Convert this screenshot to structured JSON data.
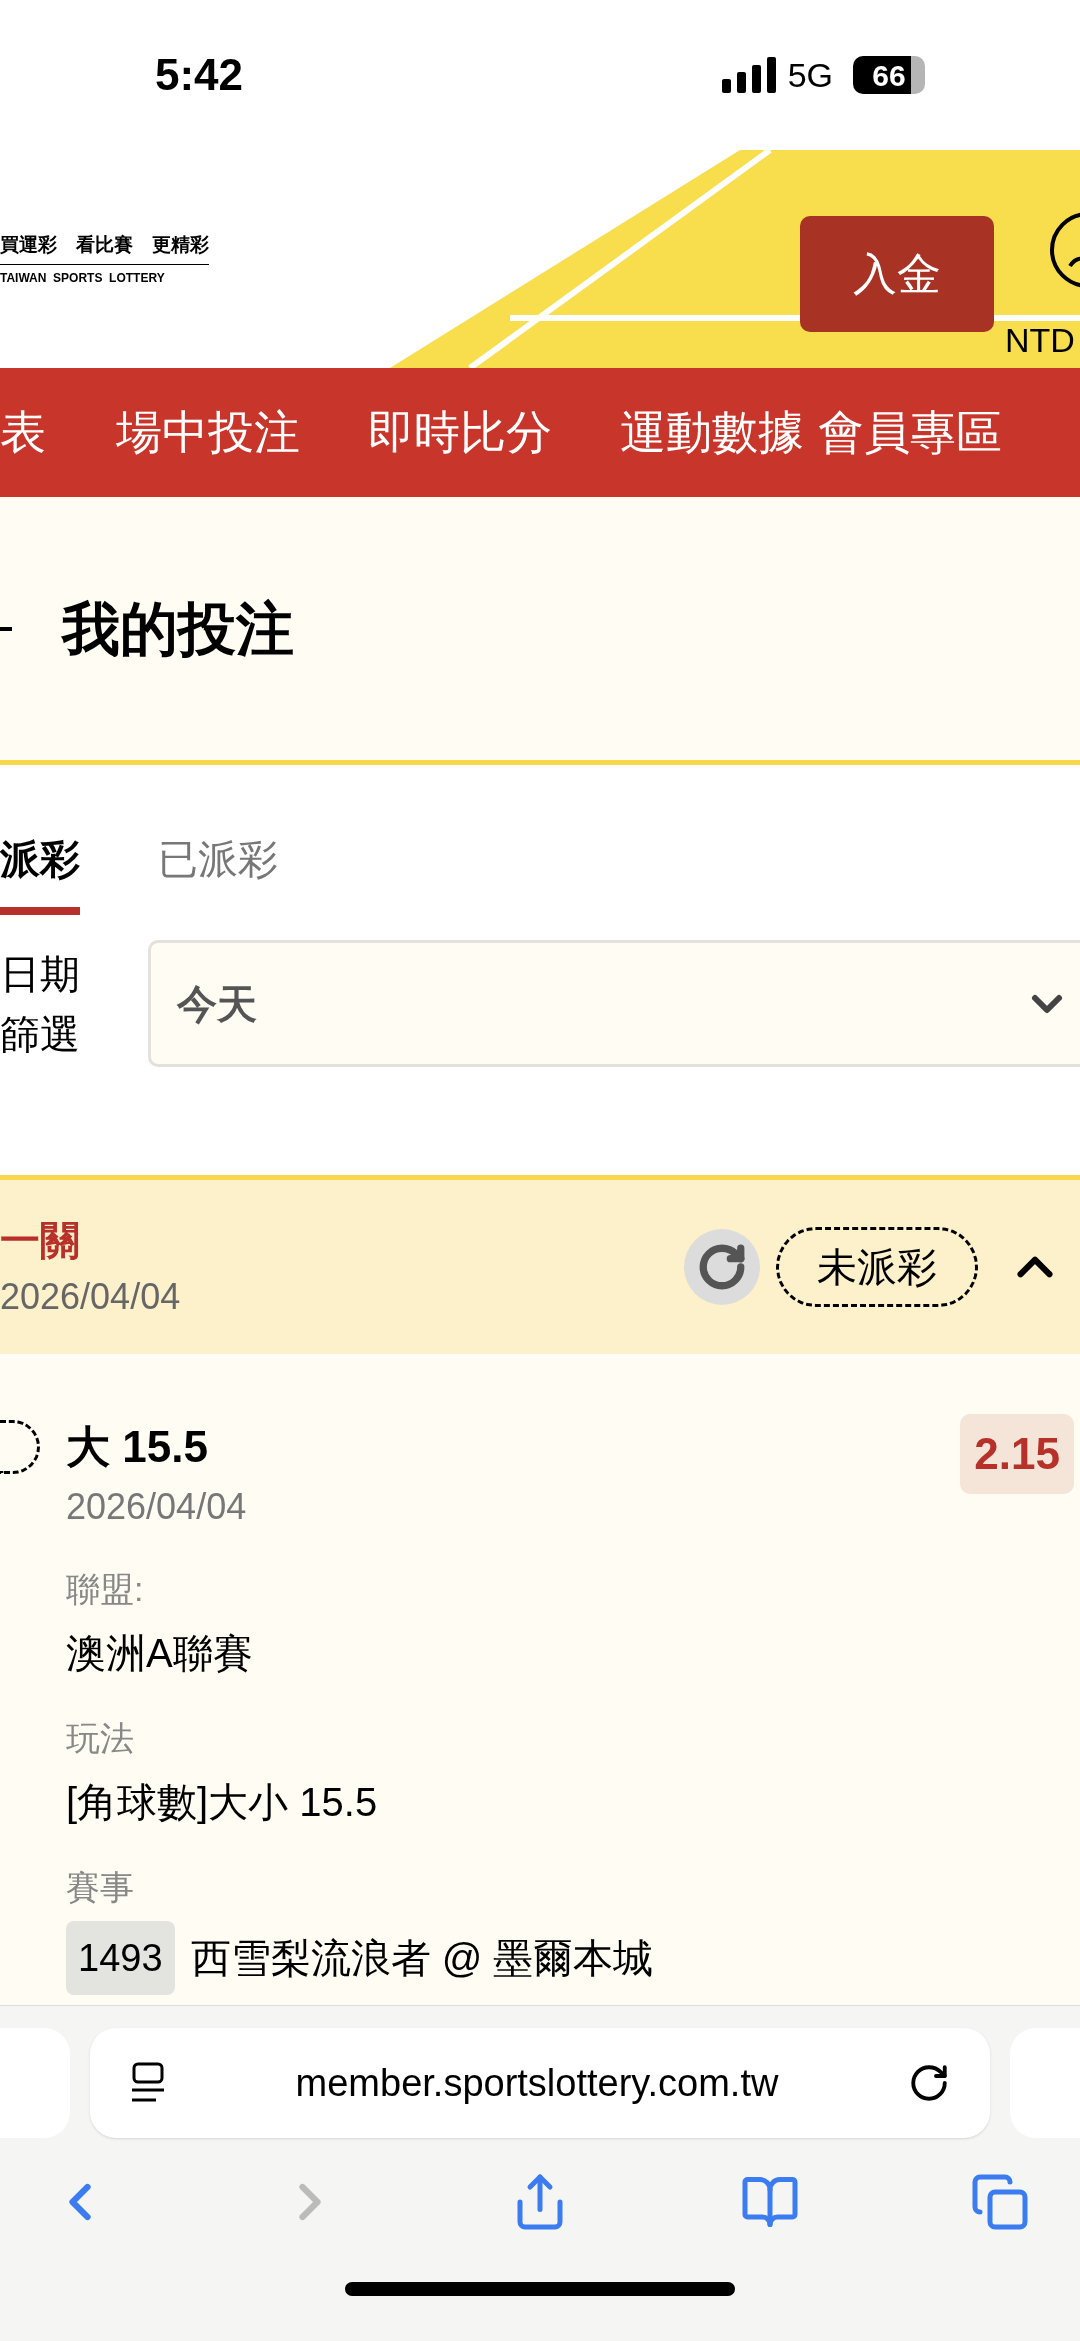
{
  "status_bar": {
    "time": "5:42",
    "network": "5G",
    "battery": "66"
  },
  "header": {
    "slogan": "買運彩　看比賽　更精彩",
    "brand": "TAIWAN  SPORTS  LOTTERY",
    "deposit_button": "入金",
    "currency": "NTD"
  },
  "nav": {
    "items": [
      "表",
      "場中投注",
      "即時比分",
      "運動數據",
      "會員專區"
    ]
  },
  "page_title": "我的投注",
  "tabs": [
    {
      "label": "派彩",
      "selected": true
    },
    {
      "label": "已派彩",
      "selected": false
    }
  ],
  "date_filter": {
    "label_lines": [
      "日期",
      "篩選"
    ],
    "value": "今天"
  },
  "bet": {
    "title": "一關",
    "date": "2026/04/04",
    "status": "未派彩",
    "expanded": true,
    "selection": {
      "pick": "大 15.5",
      "date": "2026/04/04",
      "odds": "2.15",
      "checked": false,
      "fields": [
        {
          "label": "聯盟:",
          "value": "澳洲A聯賽"
        },
        {
          "label": "玩法",
          "value": "[角球數]大小 15.5"
        },
        {
          "label": "賽事",
          "match_no": "1493",
          "value": "西雪梨流浪者 @ 墨爾本城"
        }
      ]
    }
  },
  "browser": {
    "url": "member.sportslottery.com.tw"
  }
}
